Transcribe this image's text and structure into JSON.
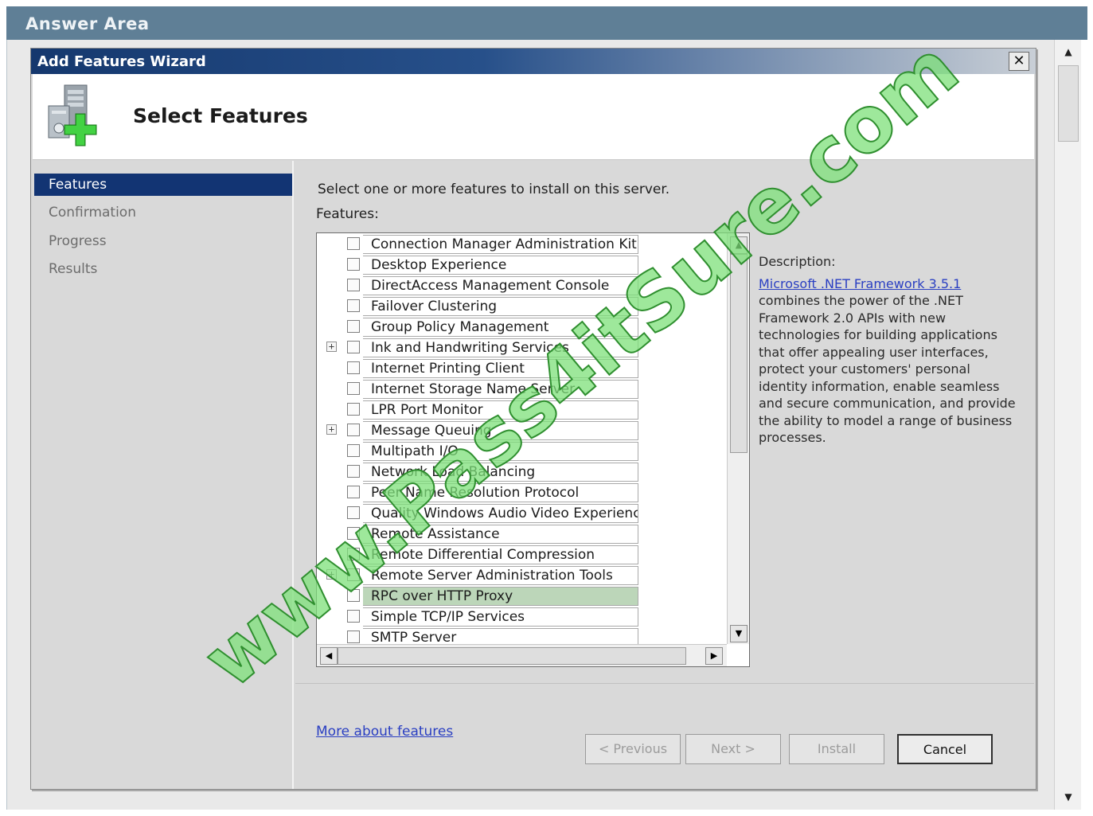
{
  "answer_area_title": "Answer Area",
  "wizard": {
    "title": "Add Features Wizard",
    "close_label": "✕",
    "header_title": "Select Features",
    "header_icon": "server-add-icon"
  },
  "nav": {
    "items": [
      {
        "label": "Features",
        "active": true
      },
      {
        "label": "Confirmation"
      },
      {
        "label": "Progress"
      },
      {
        "label": "Results"
      }
    ]
  },
  "content": {
    "instruction": "Select one or more features to install on this server.",
    "features_label": "Features:",
    "features": [
      {
        "label": "Connection Manager Administration Kit",
        "expandable": false,
        "selected": false
      },
      {
        "label": "Desktop Experience",
        "expandable": false,
        "selected": false
      },
      {
        "label": "DirectAccess Management Console",
        "expandable": false,
        "selected": false
      },
      {
        "label": "Failover Clustering",
        "expandable": false,
        "selected": false
      },
      {
        "label": "Group Policy Management",
        "expandable": false,
        "selected": false
      },
      {
        "label": "Ink and Handwriting Services",
        "expandable": true,
        "selected": false
      },
      {
        "label": "Internet Printing Client",
        "expandable": false,
        "selected": false
      },
      {
        "label": "Internet Storage Name Server",
        "expandable": false,
        "selected": false
      },
      {
        "label": "LPR Port Monitor",
        "expandable": false,
        "selected": false
      },
      {
        "label": "Message Queuing",
        "expandable": true,
        "selected": false
      },
      {
        "label": "Multipath I/O",
        "expandable": false,
        "selected": false
      },
      {
        "label": "Network Load Balancing",
        "expandable": false,
        "selected": false
      },
      {
        "label": "Peer Name Resolution Protocol",
        "expandable": false,
        "selected": false
      },
      {
        "label": "Quality Windows Audio Video Experience",
        "expandable": false,
        "selected": false
      },
      {
        "label": "Remote Assistance",
        "expandable": false,
        "selected": false
      },
      {
        "label": "Remote Differential Compression",
        "expandable": false,
        "selected": false
      },
      {
        "label": "Remote Server Administration Tools",
        "expandable": true,
        "selected": false
      },
      {
        "label": "RPC over HTTP Proxy",
        "expandable": false,
        "selected": true
      },
      {
        "label": "Simple TCP/IP Services",
        "expandable": false,
        "selected": false
      },
      {
        "label": "SMTP Server",
        "expandable": false,
        "selected": false
      }
    ],
    "more_link": "More about features",
    "description": {
      "title": "Description:",
      "link": "Microsoft .NET Framework 3.5.1",
      "text": " combines the power of the .NET Framework 2.0 APIs with new technologies for building applications that offer appealing user interfaces, protect your customers' personal identity information, enable seamless and secure communication, and provide the ability to model a range of business processes."
    }
  },
  "buttons": {
    "previous": "< Previous",
    "next": "Next >",
    "install": "Install",
    "cancel": "Cancel"
  },
  "watermark": "www.Pass4itSure.com",
  "colors": {
    "titlebar": "#15386e",
    "nav_active": "#123473",
    "selected_row": "#bcd6b9",
    "link": "#2a3fc2",
    "watermark": "#7de07a"
  }
}
